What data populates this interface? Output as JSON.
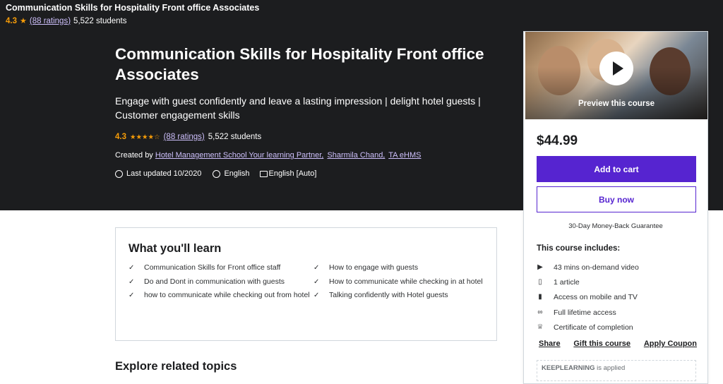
{
  "sticky": {
    "title": "Communication Skills for Hospitality Front office Associates",
    "rating": "4.3",
    "ratings_link": "(88 ratings)",
    "students": "5,522 students"
  },
  "hero": {
    "title": "Communication Skills for Hospitality Front office Associates",
    "subtitle": "Engage with guest confidently and leave a lasting impression | delight hotel guests | Customer engagement skills",
    "rating": "4.3",
    "stars": "★★★★☆",
    "ratings_link": "(88 ratings)",
    "students": "5,522 students",
    "created_by_label": "Created by",
    "instructors": [
      "Hotel Management School Your learning Partner,",
      "Sharmila Chand,",
      "TA eHMS"
    ],
    "last_updated": "Last updated 10/2020",
    "language": "English",
    "captions": "English [Auto]"
  },
  "sidebar": {
    "preview_label": "Preview this course",
    "price": "$44.99",
    "add_to_cart": "Add to cart",
    "buy_now": "Buy now",
    "guarantee": "30-Day Money-Back Guarantee",
    "includes_title": "This course includes:",
    "includes": [
      {
        "icon": "video-icon",
        "text": "43 mins on-demand video"
      },
      {
        "icon": "file-icon",
        "text": "1 article"
      },
      {
        "icon": "mobile-icon",
        "text": "Access on mobile and TV"
      },
      {
        "icon": "infinity-icon",
        "text": "Full lifetime access"
      },
      {
        "icon": "trophy-icon",
        "text": "Certificate of completion"
      }
    ],
    "links": [
      "Share",
      "Gift this course",
      "Apply Coupon"
    ],
    "coupon_code": "KEEPLEARNING",
    "coupon_status": "is applied"
  },
  "learn": {
    "title": "What you'll learn",
    "items": [
      "Communication Skills for Front office staff",
      "How to engage with guests",
      "Do and Dont in communication with guests",
      "How to communicate while checking in at hotel",
      "how to communicate while checking out from hotel",
      "Talking confidently with Hotel guests"
    ]
  },
  "explore": {
    "title": "Explore related topics"
  },
  "colors": {
    "dark_bg": "#1c1d1f",
    "accent_purple": "#5624d0",
    "star_orange": "#f69c08",
    "link_lavender": "#cec0fc"
  }
}
